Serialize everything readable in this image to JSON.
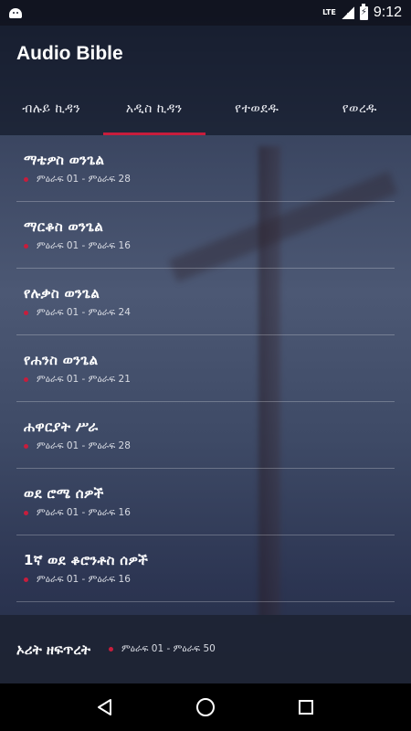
{
  "status_bar": {
    "network": "LTE",
    "time": "9:12"
  },
  "app_bar": {
    "title": "Audio Bible"
  },
  "tabs": [
    {
      "label": "ብሉይ ኪዳን",
      "active": false
    },
    {
      "label": "አዲስ ኪዳን",
      "active": true
    },
    {
      "label": "የተወደዱ",
      "active": false
    },
    {
      "label": "የወረዱ",
      "active": false
    }
  ],
  "books": [
    {
      "title": "ማቴዎስ ወንጌል",
      "chapters": "ምዕራፍ 01 - ምዕራፍ 28"
    },
    {
      "title": "ማርቆስ ወንጌል",
      "chapters": "ምዕራፍ 01 - ምዕራፍ 16"
    },
    {
      "title": "የሉቃስ ወንጌል",
      "chapters": "ምዕራፍ 01 - ምዕራፍ 24"
    },
    {
      "title": "የሐንስ ወንጌል",
      "chapters": "ምዕራፍ 01 - ምዕራፍ 21"
    },
    {
      "title": "ሐዋርያት ሥራ",
      "chapters": "ምዕራፍ 01 - ምዕራፍ 28"
    },
    {
      "title": "ወደ ሮሜ ሰዎች",
      "chapters": "ምዕራፍ 01 - ምዕራፍ 16"
    },
    {
      "title": "1ኛ ወደ ቆሮንቶስ ሰዎች",
      "chapters": "ምዕራፍ 01 - ምዕራፍ 16"
    }
  ],
  "now_playing": {
    "title": "ኦሪት ዘፍጥረት",
    "chapters": "ምዕራፍ 01 - ምዕራፍ 50"
  },
  "colors": {
    "accent": "#c81d3c"
  }
}
